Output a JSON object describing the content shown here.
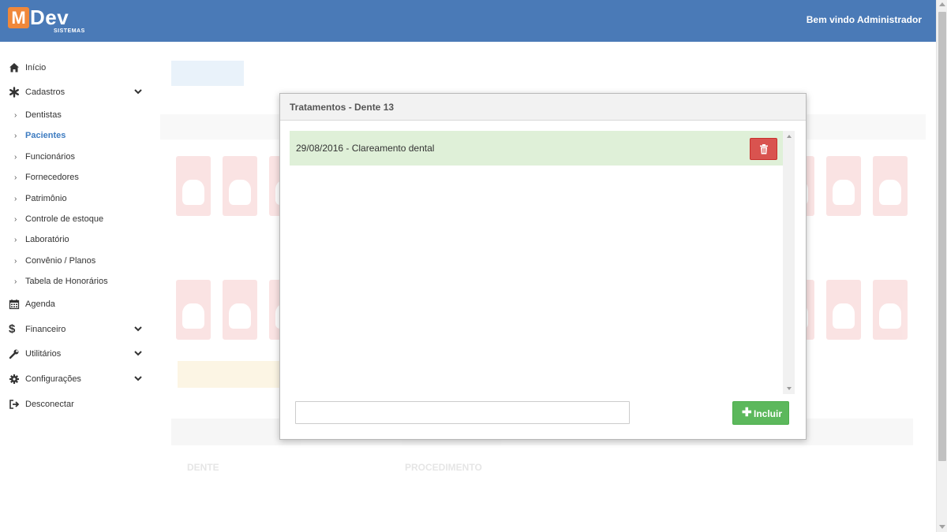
{
  "brand": {
    "letter": "M",
    "name": "Dev",
    "subtitle": "SISTEMAS",
    "accent": "#f0883a",
    "bar_color": "#4a7ab7"
  },
  "header": {
    "welcome": "Bem vindo Administrador"
  },
  "sidebar": {
    "items": [
      {
        "label": "Início",
        "icon": "home-icon"
      },
      {
        "label": "Cadastros",
        "icon": "asterisk-icon",
        "expanded": true
      },
      {
        "label": "Dentistas",
        "sub": true
      },
      {
        "label": "Pacientes",
        "sub": true,
        "active": true
      },
      {
        "label": "Funcionários",
        "sub": true
      },
      {
        "label": "Fornecedores",
        "sub": true
      },
      {
        "label": "Patrimônio",
        "sub": true
      },
      {
        "label": "Controle de estoque",
        "sub": true
      },
      {
        "label": "Laboratório",
        "sub": true
      },
      {
        "label": "Convênio / Planos",
        "sub": true
      },
      {
        "label": "Tabela de Honorários",
        "sub": true
      },
      {
        "label": "Agenda",
        "icon": "calendar-icon"
      },
      {
        "label": "Financeiro",
        "icon": "dollar-icon",
        "expanded": false
      },
      {
        "label": "Utilitários",
        "icon": "wrench-icon",
        "expanded": false
      },
      {
        "label": "Configurações",
        "icon": "gear-icon",
        "expanded": false
      },
      {
        "label": "Desconectar",
        "icon": "sign-out-icon"
      }
    ]
  },
  "background": {
    "table_headers": [
      "DENTE",
      "PROCEDIMENTO"
    ]
  },
  "modal": {
    "title": "Tratamentos - Dente 13",
    "treatments": [
      {
        "text": "29/08/2016 - Clareamento dental"
      }
    ],
    "input_value": "",
    "input_placeholder": "",
    "add_label": "Incluir",
    "delete_color": "#d9534f",
    "add_color": "#5cb85c",
    "row_color": "#dff0d8"
  }
}
